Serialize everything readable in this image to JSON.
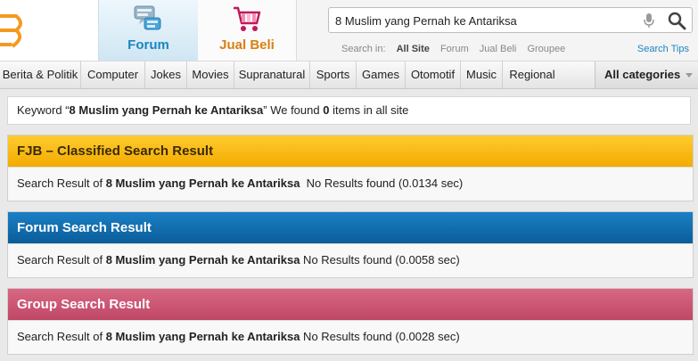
{
  "header": {
    "tabs": [
      {
        "label": "Forum",
        "icon": "forum-icon",
        "active": true
      },
      {
        "label": "Jual Beli",
        "icon": "cart-icon",
        "active": false
      }
    ],
    "search": {
      "value": "8 Muslim yang Pernah ke Antariksa",
      "search_in_label": "Search in:",
      "options": [
        "All Site",
        "Forum",
        "Jual Beli",
        "Groupee"
      ],
      "active_option": "All Site",
      "tips_label": "Search Tips"
    }
  },
  "categories": [
    "Berita & Politik",
    "Computer",
    "Jokes",
    "Movies",
    "Supranatural",
    "Sports",
    "Games",
    "Otomotif",
    "Music",
    "Regional"
  ],
  "all_categories_label": "All categories",
  "summary": {
    "prefix": "Keyword “",
    "keyword": "8 Muslim yang Pernah ke Antariksa",
    "middle": "” We found ",
    "count": "0",
    "suffix": " items in all site"
  },
  "panels": [
    {
      "title": "FJB – Classified Search Result",
      "prefix": "Search Result of ",
      "keyword": "8 Muslim yang Pernah ke Antariksa",
      "result": "  No Results found (0.0134 sec)",
      "color": "#f3ab00"
    },
    {
      "title": "Forum Search Result",
      "prefix": "Search Result of ",
      "keyword": "8 Muslim yang Pernah ke Antariksa",
      "result": " No Results found (0.0058 sec)",
      "color": "#0b5d9a"
    },
    {
      "title": "Group Search Result",
      "prefix": "Search Result of ",
      "keyword": "8 Muslim yang Pernah ke Antariksa",
      "result": " No Results found (0.0028 sec)",
      "color": "#bf4766"
    }
  ]
}
